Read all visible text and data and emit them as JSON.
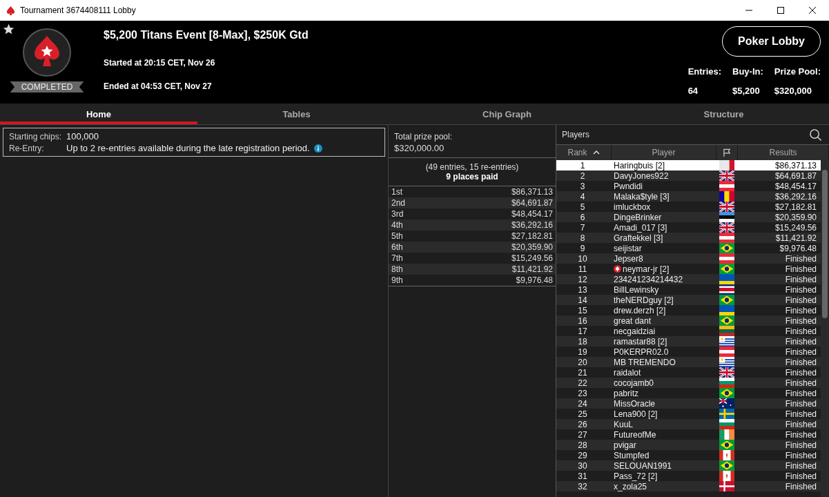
{
  "window": {
    "title": "Tournament 3674408111 Lobby"
  },
  "header": {
    "favorite": true,
    "status": "COMPLETED",
    "event_name": "$5,200 Titans Event [8-Max], $250K Gtd",
    "started": "Started at 20:15 CET, Nov 26",
    "ended": "Ended at 04:53 CET, Nov 27",
    "lobby_button": "Poker Lobby",
    "stats": [
      {
        "label": "Entries:",
        "value": "64"
      },
      {
        "label": "Buy-In:",
        "value": "$5,200"
      },
      {
        "label": "Prize Pool:",
        "value": "$320,000"
      }
    ]
  },
  "tabs": [
    {
      "label": "Home",
      "selected": true
    },
    {
      "label": "Tables",
      "selected": false
    },
    {
      "label": "Chip Graph",
      "selected": false
    },
    {
      "label": "Structure",
      "selected": false
    }
  ],
  "info": [
    {
      "label": "Starting chips:",
      "value": "100,000",
      "info_icon": false
    },
    {
      "label": "Re-Entry:",
      "value": "Up to 2 re-entries available during the late registration period.",
      "info_icon": true
    }
  ],
  "prizes": {
    "total_label": "Total prize pool:",
    "total": "$320,000.00",
    "entries": "(49 entries, 15 re-entries)",
    "places_paid": "9 places paid",
    "rows": [
      {
        "place": "1st",
        "amount": "$86,371.13"
      },
      {
        "place": "2nd",
        "amount": "$64,691.87"
      },
      {
        "place": "3rd",
        "amount": "$48,454.17"
      },
      {
        "place": "4th",
        "amount": "$36,292.16"
      },
      {
        "place": "5th",
        "amount": "$27,182.81"
      },
      {
        "place": "6th",
        "amount": "$20,359.90"
      },
      {
        "place": "7th",
        "amount": "$15,249.56"
      },
      {
        "place": "8th",
        "amount": "$11,421.92"
      },
      {
        "place": "9th",
        "amount": "$9,976.48"
      }
    ]
  },
  "players": {
    "title": "Players",
    "columns": [
      {
        "label": "Rank",
        "sorted": true
      },
      {
        "label": "Player",
        "sorted": false
      },
      {
        "label": "Results",
        "sorted": false
      }
    ],
    "rows": [
      {
        "rank": "1",
        "name": "Haringbuis [2]",
        "kind": "mt",
        "badge": false,
        "result": "$86,371.13",
        "selected": true
      },
      {
        "rank": "2",
        "name": "DavyJones922",
        "kind": "gb",
        "badge": false,
        "result": "$64,691.87",
        "selected": false
      },
      {
        "rank": "3",
        "name": "Pwndidi",
        "kind": "at",
        "badge": false,
        "result": "$48,454.17",
        "selected": false
      },
      {
        "rank": "4",
        "name": "Malaka$tyle [3]",
        "kind": "ad",
        "badge": false,
        "result": "$36,292.16",
        "selected": false
      },
      {
        "rank": "5",
        "name": "imluckbox",
        "kind": "gb",
        "badge": false,
        "result": "$27,182.81",
        "selected": false
      },
      {
        "rank": "6",
        "name": "DingeBrinker",
        "kind": "ee",
        "badge": false,
        "result": "$20,359.90",
        "selected": false
      },
      {
        "rank": "7",
        "name": "Amadi_017 [3]",
        "kind": "gb",
        "badge": false,
        "result": "$15,249.56",
        "selected": false
      },
      {
        "rank": "8",
        "name": "Graftekkel [3]",
        "kind": "at",
        "badge": false,
        "result": "$11,421.92",
        "selected": false
      },
      {
        "rank": "9",
        "name": "seijistar",
        "kind": "br",
        "badge": false,
        "result": "$9,976.48",
        "selected": false
      },
      {
        "rank": "10",
        "name": "Jepser8",
        "kind": "at",
        "badge": false,
        "result": "Finished",
        "selected": false
      },
      {
        "rank": "11",
        "name": "neymar-jr [2]",
        "kind": "br",
        "badge": true,
        "result": "Finished",
        "selected": false
      },
      {
        "rank": "12",
        "name": "234241234214432",
        "kind": "ua",
        "badge": false,
        "result": "Finished",
        "selected": false
      },
      {
        "rank": "13",
        "name": "BillLewinsky",
        "kind": "cr",
        "badge": false,
        "result": "Finished",
        "selected": false
      },
      {
        "rank": "14",
        "name": "theNERDguy [2]",
        "kind": "br",
        "badge": false,
        "result": "Finished",
        "selected": false
      },
      {
        "rank": "15",
        "name": "drew.derzh [2]",
        "kind": "ua",
        "badge": false,
        "result": "Finished",
        "selected": false
      },
      {
        "rank": "16",
        "name": "great dant",
        "kind": "br",
        "badge": false,
        "result": "Finished",
        "selected": false
      },
      {
        "rank": "17",
        "name": "necgaidziai",
        "kind": "lt",
        "badge": false,
        "result": "Finished",
        "selected": false
      },
      {
        "rank": "18",
        "name": "ramastar88 [2]",
        "kind": "uy",
        "badge": false,
        "result": "Finished",
        "selected": false
      },
      {
        "rank": "19",
        "name": "P0KERPR02.0",
        "kind": "at",
        "badge": false,
        "result": "Finished",
        "selected": false
      },
      {
        "rank": "20",
        "name": "MB TREMENDO",
        "kind": "uy",
        "badge": false,
        "result": "Finished",
        "selected": false
      },
      {
        "rank": "21",
        "name": "raidalot",
        "kind": "gb",
        "badge": false,
        "result": "Finished",
        "selected": false
      },
      {
        "rank": "22",
        "name": "cocojamb0",
        "kind": "bg",
        "badge": false,
        "result": "Finished",
        "selected": false
      },
      {
        "rank": "23",
        "name": "pabritz",
        "kind": "br",
        "badge": false,
        "result": "Finished",
        "selected": false
      },
      {
        "rank": "24",
        "name": "MissOracle",
        "kind": "au",
        "badge": false,
        "result": "Finished",
        "selected": false
      },
      {
        "rank": "25",
        "name": "Lena900 [2]",
        "kind": "se",
        "badge": false,
        "result": "Finished",
        "selected": false
      },
      {
        "rank": "26",
        "name": "KuuL",
        "kind": "bg",
        "badge": false,
        "result": "Finished",
        "selected": false
      },
      {
        "rank": "27",
        "name": "FutureofMe",
        "kind": "ie",
        "badge": false,
        "result": "Finished",
        "selected": false
      },
      {
        "rank": "28",
        "name": "pvigar",
        "kind": "br",
        "badge": false,
        "result": "Finished",
        "selected": false
      },
      {
        "rank": "29",
        "name": "Stumpfed",
        "kind": "ca",
        "badge": false,
        "result": "Finished",
        "selected": false
      },
      {
        "rank": "30",
        "name": "SELOUAN1991",
        "kind": "br",
        "badge": false,
        "result": "Finished",
        "selected": false
      },
      {
        "rank": "31",
        "name": "Pass_72 [2]",
        "kind": "ca",
        "badge": false,
        "result": "Finished",
        "selected": false
      },
      {
        "rank": "32",
        "name": "x_zola25",
        "kind": "dk",
        "badge": false,
        "result": "Finished",
        "selected": false
      }
    ]
  }
}
